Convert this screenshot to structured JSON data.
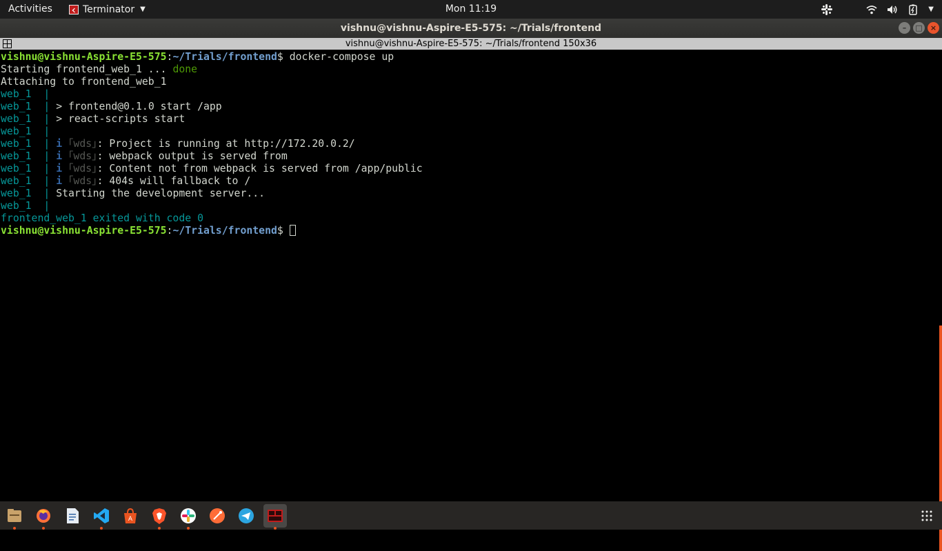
{
  "topbar": {
    "activities": "Activities",
    "app_menu": "Terminator",
    "clock": "Mon 11:19",
    "tray_icons": [
      "slack-icon",
      "wifi-icon",
      "volume-icon",
      "battery-icon",
      "power-menu-icon"
    ]
  },
  "window": {
    "title": "vishnu@vishnu-Aspire-E5-575: ~/Trials/frontend",
    "pane_title": "vishnu@vishnu-Aspire-E5-575: ~/Trials/frontend 150x36",
    "controls": {
      "minimize": "–",
      "maximize": "□",
      "close": "×"
    }
  },
  "terminal": {
    "prompt_user": "vishnu@vishnu-Aspire-E5-575",
    "prompt_sep": ":",
    "prompt_path": "~/Trials/frontend",
    "prompt_symbol": "$ ",
    "command": "docker-compose up",
    "starting_text": "Starting frontend_web_1 ... ",
    "starting_status": "done",
    "attaching": "Attaching to frontend_web_1",
    "service_prefix": "web_1  | ",
    "info_mark": "i",
    "wds_tag": "｢wds｣",
    "log_lines": [
      {
        "kind": "blank"
      },
      {
        "kind": "text",
        "text": "> frontend@0.1.0 start /app"
      },
      {
        "kind": "text",
        "text": "> react-scripts start"
      },
      {
        "kind": "blank"
      },
      {
        "kind": "wds",
        "text": ": Project is running at http://172.20.0.2/"
      },
      {
        "kind": "wds",
        "text": ": webpack output is served from"
      },
      {
        "kind": "wds",
        "text": ": Content not from webpack is served from /app/public"
      },
      {
        "kind": "wds",
        "text": ": 404s will fallback to /"
      },
      {
        "kind": "text",
        "text": "Starting the development server..."
      },
      {
        "kind": "blank"
      }
    ],
    "exit_line": "frontend_web_1 exited with code 0"
  },
  "dock": {
    "items": [
      {
        "name": "files-icon",
        "color": "#c9a26a",
        "running": true
      },
      {
        "name": "firefox-icon",
        "color": "#ff7139",
        "running": true
      },
      {
        "name": "text-editor-icon",
        "color": "#e7edf4",
        "running": false
      },
      {
        "name": "vscode-icon",
        "color": "#23a9f2",
        "running": true
      },
      {
        "name": "software-center-icon",
        "color": "#e95420",
        "running": false
      },
      {
        "name": "brave-icon",
        "color": "#fb542b",
        "running": true
      },
      {
        "name": "slack-icon",
        "color": "#e01e5a",
        "running": true
      },
      {
        "name": "postman-icon",
        "color": "#ff6c37",
        "running": false
      },
      {
        "name": "telegram-icon",
        "color": "#2ca5e0",
        "running": false
      },
      {
        "name": "terminator-icon",
        "color": "#c01c1c",
        "running": true,
        "active": true
      }
    ]
  }
}
